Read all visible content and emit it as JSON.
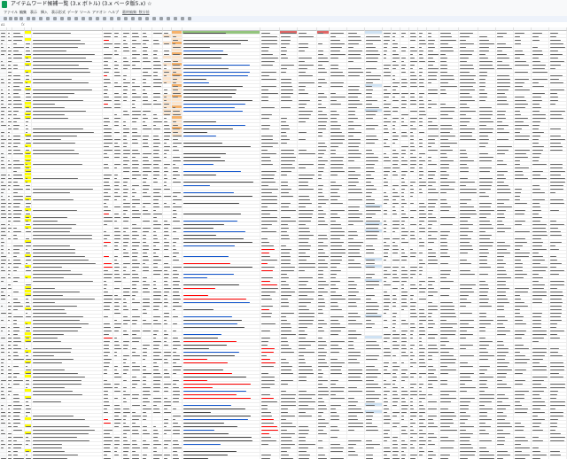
{
  "window": {
    "title": "アイテムワード候補一覧 (3.x ボトル) (3.x ベータ版5.x) ☆",
    "menu": [
      "ファイル",
      "編集",
      "表示",
      "挿入",
      "表示形式",
      "データ",
      "ツール",
      "アドオン",
      "ヘルプ",
      "最終編集: 数分前"
    ]
  },
  "formula_bar": {
    "name_box": "A1",
    "fx": "fx"
  },
  "colors": {
    "header_bg": "#f8f9fa",
    "gridline": "#eeeeee",
    "yellow": "#ffff00",
    "orange": "#f6b26b",
    "light_orange": "#fce5cd",
    "red": "#e06666",
    "green": "#93c47d",
    "blue_text": "#1155cc",
    "red_text": "#ff0000",
    "light_blue": "#cfe2f3"
  }
}
